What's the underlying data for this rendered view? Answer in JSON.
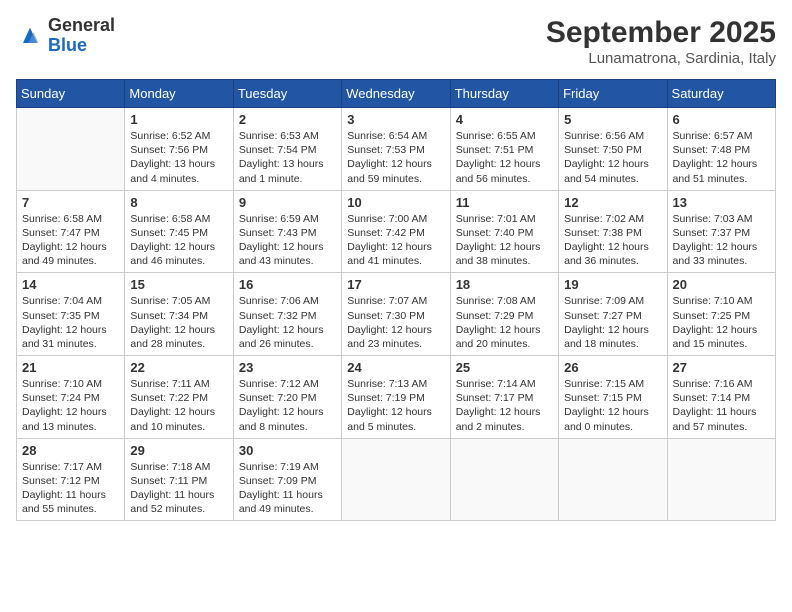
{
  "logo": {
    "general": "General",
    "blue": "Blue"
  },
  "title": "September 2025",
  "location": "Lunamatrona, Sardinia, Italy",
  "weekdays": [
    "Sunday",
    "Monday",
    "Tuesday",
    "Wednesday",
    "Thursday",
    "Friday",
    "Saturday"
  ],
  "weeks": [
    [
      {
        "day": "",
        "info": ""
      },
      {
        "day": "1",
        "info": "Sunrise: 6:52 AM\nSunset: 7:56 PM\nDaylight: 13 hours\nand 4 minutes."
      },
      {
        "day": "2",
        "info": "Sunrise: 6:53 AM\nSunset: 7:54 PM\nDaylight: 13 hours\nand 1 minute."
      },
      {
        "day": "3",
        "info": "Sunrise: 6:54 AM\nSunset: 7:53 PM\nDaylight: 12 hours\nand 59 minutes."
      },
      {
        "day": "4",
        "info": "Sunrise: 6:55 AM\nSunset: 7:51 PM\nDaylight: 12 hours\nand 56 minutes."
      },
      {
        "day": "5",
        "info": "Sunrise: 6:56 AM\nSunset: 7:50 PM\nDaylight: 12 hours\nand 54 minutes."
      },
      {
        "day": "6",
        "info": "Sunrise: 6:57 AM\nSunset: 7:48 PM\nDaylight: 12 hours\nand 51 minutes."
      }
    ],
    [
      {
        "day": "7",
        "info": "Sunrise: 6:58 AM\nSunset: 7:47 PM\nDaylight: 12 hours\nand 49 minutes."
      },
      {
        "day": "8",
        "info": "Sunrise: 6:58 AM\nSunset: 7:45 PM\nDaylight: 12 hours\nand 46 minutes."
      },
      {
        "day": "9",
        "info": "Sunrise: 6:59 AM\nSunset: 7:43 PM\nDaylight: 12 hours\nand 43 minutes."
      },
      {
        "day": "10",
        "info": "Sunrise: 7:00 AM\nSunset: 7:42 PM\nDaylight: 12 hours\nand 41 minutes."
      },
      {
        "day": "11",
        "info": "Sunrise: 7:01 AM\nSunset: 7:40 PM\nDaylight: 12 hours\nand 38 minutes."
      },
      {
        "day": "12",
        "info": "Sunrise: 7:02 AM\nSunset: 7:38 PM\nDaylight: 12 hours\nand 36 minutes."
      },
      {
        "day": "13",
        "info": "Sunrise: 7:03 AM\nSunset: 7:37 PM\nDaylight: 12 hours\nand 33 minutes."
      }
    ],
    [
      {
        "day": "14",
        "info": "Sunrise: 7:04 AM\nSunset: 7:35 PM\nDaylight: 12 hours\nand 31 minutes."
      },
      {
        "day": "15",
        "info": "Sunrise: 7:05 AM\nSunset: 7:34 PM\nDaylight: 12 hours\nand 28 minutes."
      },
      {
        "day": "16",
        "info": "Sunrise: 7:06 AM\nSunset: 7:32 PM\nDaylight: 12 hours\nand 26 minutes."
      },
      {
        "day": "17",
        "info": "Sunrise: 7:07 AM\nSunset: 7:30 PM\nDaylight: 12 hours\nand 23 minutes."
      },
      {
        "day": "18",
        "info": "Sunrise: 7:08 AM\nSunset: 7:29 PM\nDaylight: 12 hours\nand 20 minutes."
      },
      {
        "day": "19",
        "info": "Sunrise: 7:09 AM\nSunset: 7:27 PM\nDaylight: 12 hours\nand 18 minutes."
      },
      {
        "day": "20",
        "info": "Sunrise: 7:10 AM\nSunset: 7:25 PM\nDaylight: 12 hours\nand 15 minutes."
      }
    ],
    [
      {
        "day": "21",
        "info": "Sunrise: 7:10 AM\nSunset: 7:24 PM\nDaylight: 12 hours\nand 13 minutes."
      },
      {
        "day": "22",
        "info": "Sunrise: 7:11 AM\nSunset: 7:22 PM\nDaylight: 12 hours\nand 10 minutes."
      },
      {
        "day": "23",
        "info": "Sunrise: 7:12 AM\nSunset: 7:20 PM\nDaylight: 12 hours\nand 8 minutes."
      },
      {
        "day": "24",
        "info": "Sunrise: 7:13 AM\nSunset: 7:19 PM\nDaylight: 12 hours\nand 5 minutes."
      },
      {
        "day": "25",
        "info": "Sunrise: 7:14 AM\nSunset: 7:17 PM\nDaylight: 12 hours\nand 2 minutes."
      },
      {
        "day": "26",
        "info": "Sunrise: 7:15 AM\nSunset: 7:15 PM\nDaylight: 12 hours\nand 0 minutes."
      },
      {
        "day": "27",
        "info": "Sunrise: 7:16 AM\nSunset: 7:14 PM\nDaylight: 11 hours\nand 57 minutes."
      }
    ],
    [
      {
        "day": "28",
        "info": "Sunrise: 7:17 AM\nSunset: 7:12 PM\nDaylight: 11 hours\nand 55 minutes."
      },
      {
        "day": "29",
        "info": "Sunrise: 7:18 AM\nSunset: 7:11 PM\nDaylight: 11 hours\nand 52 minutes."
      },
      {
        "day": "30",
        "info": "Sunrise: 7:19 AM\nSunset: 7:09 PM\nDaylight: 11 hours\nand 49 minutes."
      },
      {
        "day": "",
        "info": ""
      },
      {
        "day": "",
        "info": ""
      },
      {
        "day": "",
        "info": ""
      },
      {
        "day": "",
        "info": ""
      }
    ]
  ]
}
